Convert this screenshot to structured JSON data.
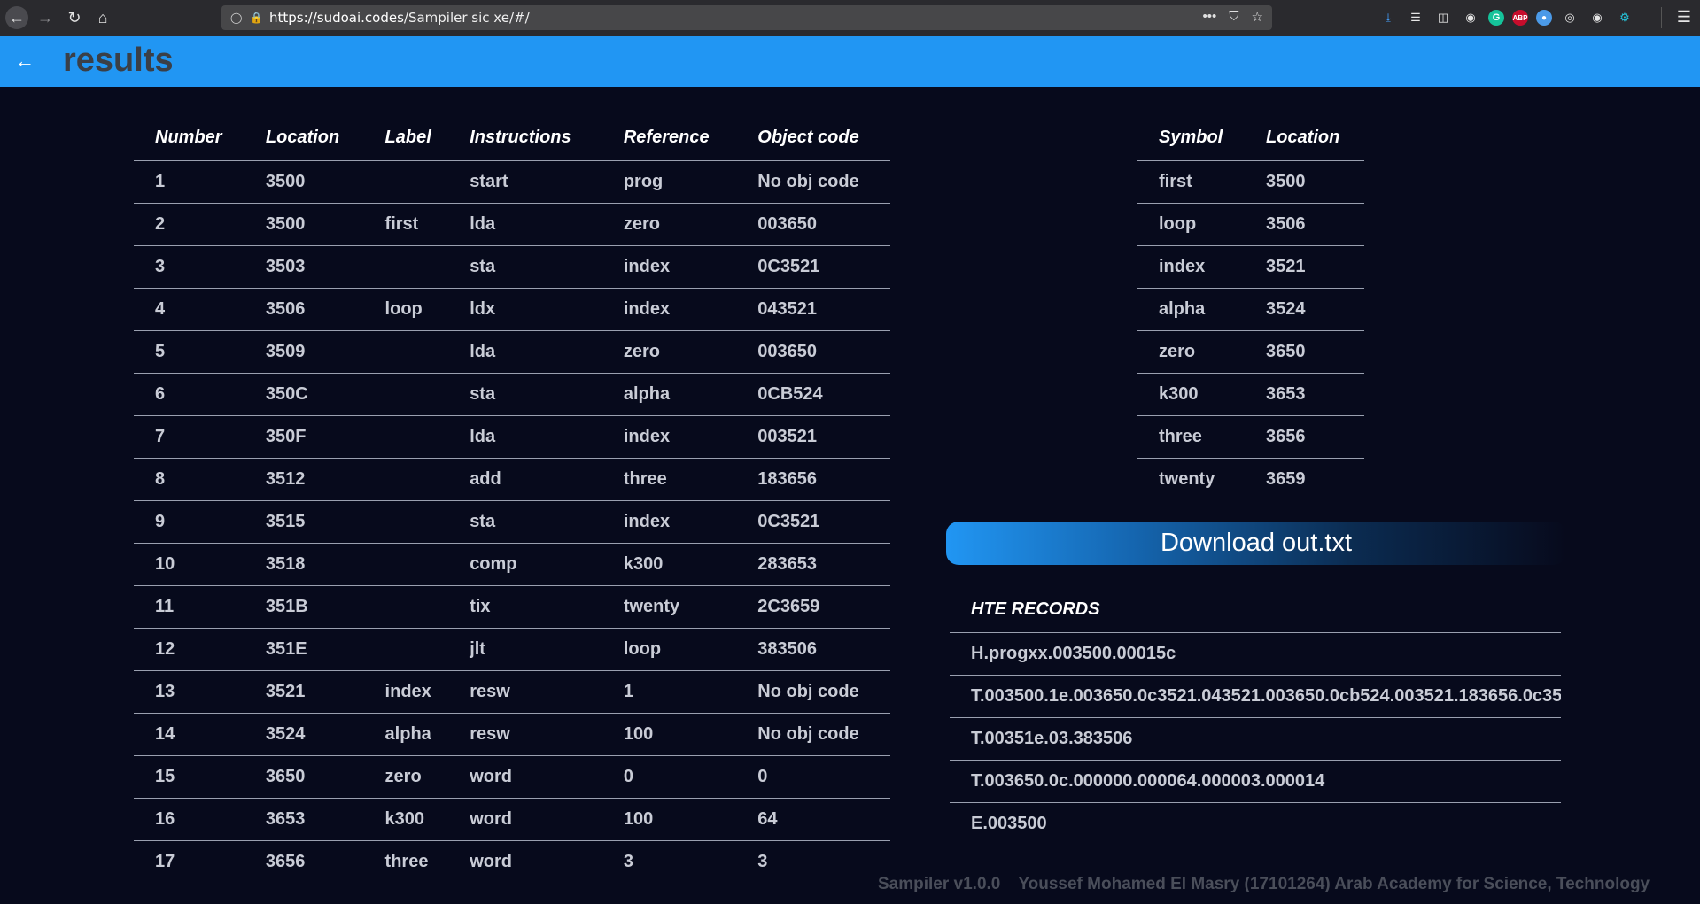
{
  "browser": {
    "url_host": "https://sudoai.codes",
    "url_path": "/Sampiler sic xe/#/",
    "url_actions": [
      "•••",
      "⛉",
      "☆"
    ],
    "toolbar_icons": [
      "download-icon",
      "library-icon",
      "sidebar-icon",
      "account-icon",
      "grammarly-icon",
      "adblock-icon",
      "extension-blue-icon",
      "extension-fingerprint-icon",
      "globe-icon",
      "settings-extension-icon",
      "menu-icon"
    ],
    "grammarly_label": "G",
    "abp_label": "ABP"
  },
  "header": {
    "title": "results",
    "accent_color": "#2196f3"
  },
  "instructions_table": {
    "columns": [
      "Number",
      "Location",
      "Label",
      "Instructions",
      "Reference",
      "Object code"
    ],
    "rows": [
      [
        "1",
        "3500",
        "",
        "start",
        "prog",
        "No obj code"
      ],
      [
        "2",
        "3500",
        "first",
        "lda",
        "zero",
        "003650"
      ],
      [
        "3",
        "3503",
        "",
        "sta",
        "index",
        "0C3521"
      ],
      [
        "4",
        "3506",
        "loop",
        "ldx",
        "index",
        "043521"
      ],
      [
        "5",
        "3509",
        "",
        "lda",
        "zero",
        "003650"
      ],
      [
        "6",
        "350C",
        "",
        "sta",
        "alpha",
        "0CB524"
      ],
      [
        "7",
        "350F",
        "",
        "lda",
        "index",
        "003521"
      ],
      [
        "8",
        "3512",
        "",
        "add",
        "three",
        "183656"
      ],
      [
        "9",
        "3515",
        "",
        "sta",
        "index",
        "0C3521"
      ],
      [
        "10",
        "3518",
        "",
        "comp",
        "k300",
        "283653"
      ],
      [
        "11",
        "351B",
        "",
        "tix",
        "twenty",
        "2C3659"
      ],
      [
        "12",
        "351E",
        "",
        "jlt",
        "loop",
        "383506"
      ],
      [
        "13",
        "3521",
        "index",
        "resw",
        "1",
        "No obj code"
      ],
      [
        "14",
        "3524",
        "alpha",
        "resw",
        "100",
        "No obj code"
      ],
      [
        "15",
        "3650",
        "zero",
        "word",
        "0",
        "0"
      ],
      [
        "16",
        "3653",
        "k300",
        "word",
        "100",
        "64"
      ],
      [
        "17",
        "3656",
        "three",
        "word",
        "3",
        "3"
      ]
    ]
  },
  "symbol_table": {
    "columns": [
      "Symbol",
      "Location"
    ],
    "rows": [
      [
        "first",
        "3500"
      ],
      [
        "loop",
        "3506"
      ],
      [
        "index",
        "3521"
      ],
      [
        "alpha",
        "3524"
      ],
      [
        "zero",
        "3650"
      ],
      [
        "k300",
        "3653"
      ],
      [
        "three",
        "3656"
      ],
      [
        "twenty",
        "3659"
      ]
    ]
  },
  "download_button": {
    "label": "Download out.txt"
  },
  "hte_records": {
    "heading": "HTE RECORDS",
    "rows": [
      "H.progxx.003500.00015c",
      "T.003500.1e.003650.0c3521.043521.003650.0cb524.003521.183656.0c35",
      "T.00351e.03.383506",
      "T.003650.0c.000000.000064.000003.000014",
      "E.003500"
    ]
  },
  "footer": {
    "version": "Sampiler v1.0.0",
    "author": "Youssef Mohamed El Masry (17101264) Arab Academy for Science, Technology"
  }
}
